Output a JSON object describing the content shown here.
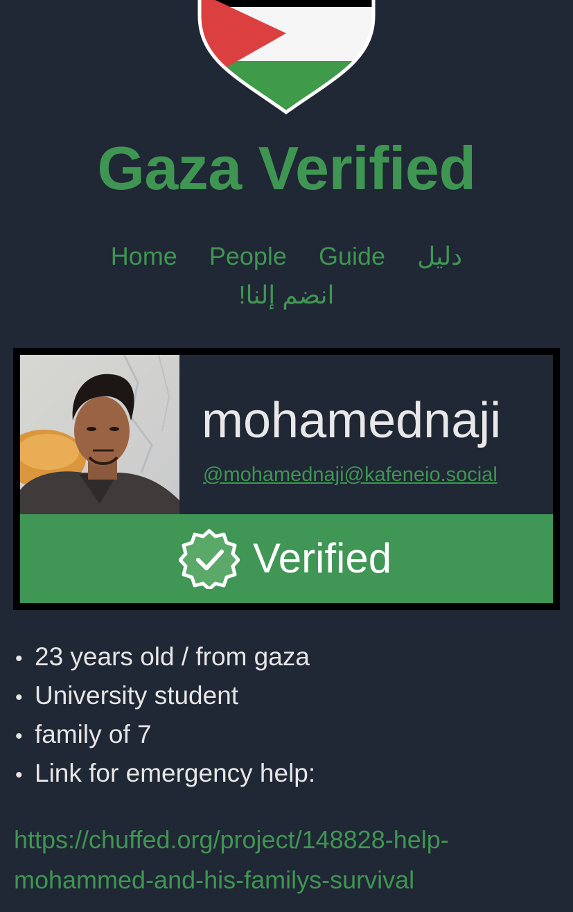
{
  "site": {
    "title": "Gaza Verified"
  },
  "nav": {
    "items": [
      {
        "label": "Home"
      },
      {
        "label": "People"
      },
      {
        "label": "Guide"
      },
      {
        "label": "دليل"
      },
      {
        "label": "انضم إلنا!"
      }
    ]
  },
  "profile": {
    "username": "mohamednaji",
    "handle": "@mohamednaji@kafeneio.social",
    "status_label": "Verified",
    "avatar_icon": "profile-photo",
    "badge_icon": "verified-badge-icon"
  },
  "facts": [
    "23 years old / from gaza",
    "University student",
    "family of 7",
    "Link for emergency help:"
  ],
  "bullet_char": "•",
  "help_link": {
    "line1": "https://chuffed.org/project/148828-help-",
    "line2": "mohammed-and-his-familys-survival"
  },
  "colors": {
    "background": "#202735",
    "accent_green": "#3f9652",
    "verified_bar": "#409655",
    "flag_red": "#dc3f3f",
    "flag_black": "#000000",
    "flag_white": "#f5f5f5",
    "flag_green": "#3f9a4a"
  }
}
